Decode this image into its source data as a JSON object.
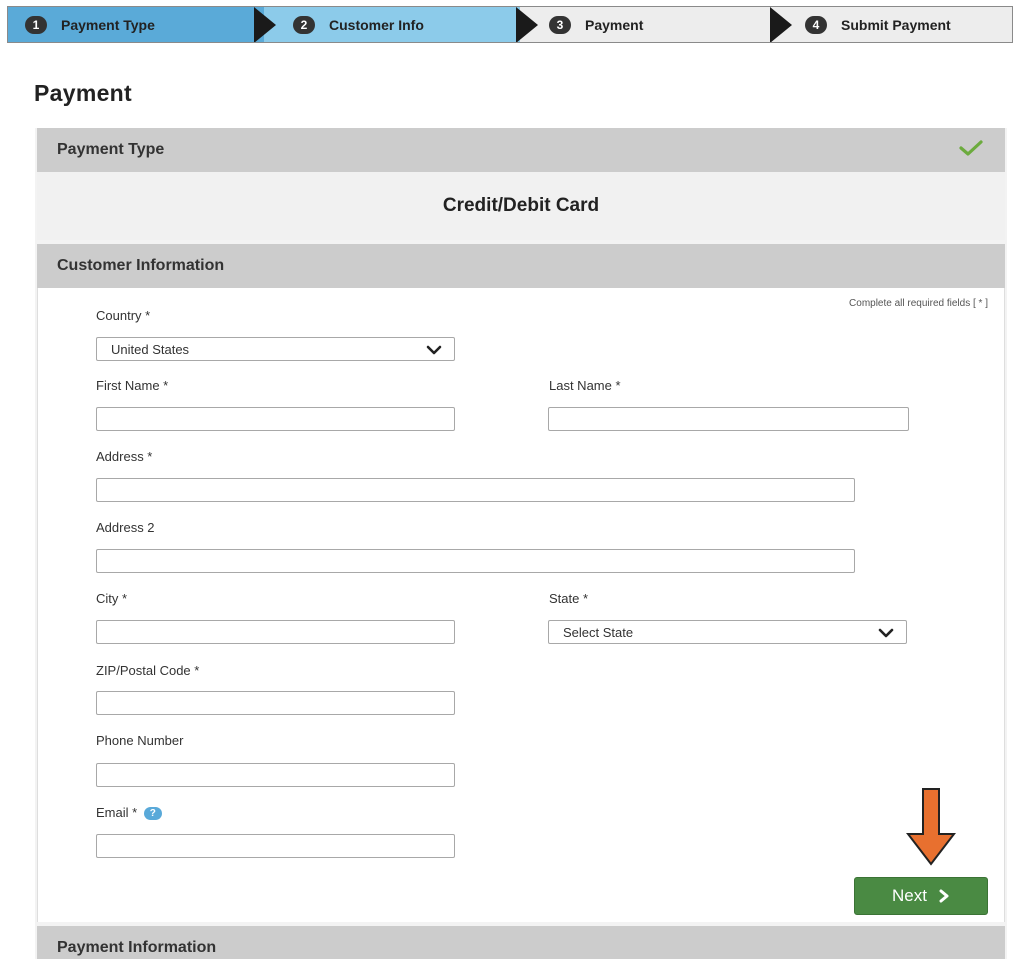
{
  "steps": [
    {
      "number": "1",
      "label": "Payment Type"
    },
    {
      "number": "2",
      "label": "Customer Info"
    },
    {
      "number": "3",
      "label": "Payment"
    },
    {
      "number": "4",
      "label": "Submit Payment"
    }
  ],
  "page": {
    "title": "Payment"
  },
  "payment_type": {
    "header": "Payment Type",
    "value": "Credit/Debit Card",
    "complete_icon": "check-icon"
  },
  "customer_info": {
    "header": "Customer Information",
    "required_note": "Complete all required fields [ * ]",
    "fields": {
      "country": {
        "label": "Country *",
        "value": "United States"
      },
      "first_name": {
        "label": "First Name *",
        "value": ""
      },
      "last_name": {
        "label": "Last Name *",
        "value": ""
      },
      "address": {
        "label": "Address *",
        "value": ""
      },
      "address2": {
        "label": "Address 2",
        "value": ""
      },
      "city": {
        "label": "City *",
        "value": ""
      },
      "state": {
        "label": "State *",
        "value": "Select State"
      },
      "zip": {
        "label": "ZIP/Postal Code *",
        "value": ""
      },
      "phone": {
        "label": "Phone Number",
        "value": ""
      },
      "email": {
        "label": "Email *",
        "value": "",
        "help": "?"
      }
    },
    "next_label": "Next"
  },
  "payment_info": {
    "header": "Payment Information"
  },
  "colors": {
    "step_active": "#59a9d9",
    "step_active_light": "#8fcbe9",
    "step_inactive": "#ededed",
    "next_button": "#4a8a43",
    "annotation_arrow": "#e8702f",
    "check": "#6cab3e"
  }
}
